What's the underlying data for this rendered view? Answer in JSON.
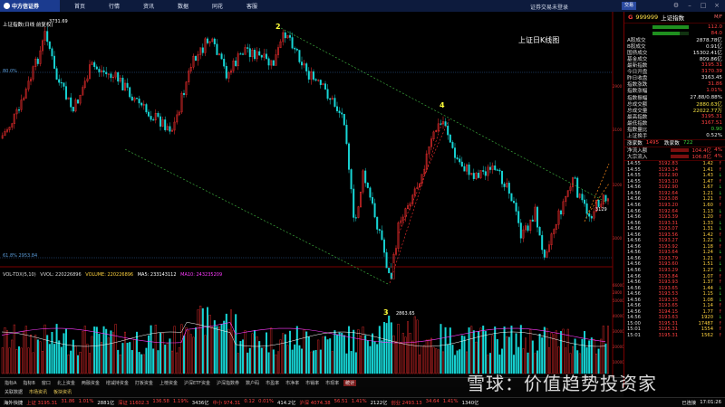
{
  "topbar": {
    "logo_text": "中方信证券",
    "menu": [
      "首页",
      "行情",
      "资讯",
      "数据",
      "同花",
      "客服"
    ],
    "app_title": "证券交易未登录",
    "login_label": "交易"
  },
  "chart": {
    "index_title": "上证指数(日线 前复权)",
    "annotation_title": "上证日K线图",
    "high_label": "3731.69",
    "low_label": "2863.65",
    "low_mark": "3",
    "wave_labels": [
      "2",
      "4"
    ],
    "left_pct_top": "80.0%",
    "left_pct_bottom": "61.8% 2953.84",
    "right_axis": [
      "3200",
      "3100",
      "3000",
      "2900",
      "2800"
    ],
    "vol_axis": [
      "66000",
      "50000",
      "40000",
      "30000",
      "20000",
      "10000"
    ],
    "current_label": "3129",
    "volume_legend": {
      "title": "VOL-TDX(5,10)",
      "vvol": "VVOL: 220226896",
      "volume": "VOLUME: 220226896",
      "ma5": "MA5: 233143112",
      "ma10": "MA10: 243235209"
    }
  },
  "right_panel": {
    "code": "999999",
    "name": "上证指数",
    "g_mark": "G",
    "tag": "M/F",
    "top_bars": [
      {
        "label": "",
        "value": "112.0"
      },
      {
        "label": "",
        "value": "84.0"
      }
    ],
    "quote_rows": [
      {
        "label": "A股成交",
        "value": "2878.78亿",
        "cls": "white"
      },
      {
        "label": "B股成交",
        "value": "0.91亿",
        "cls": "white"
      },
      {
        "label": "国债成交",
        "value": "15302.41亿",
        "cls": "white"
      },
      {
        "label": "基金成交",
        "value": "809.86亿",
        "cls": "white"
      },
      {
        "label": "最新指数",
        "value": "3195.31",
        "cls": "red"
      },
      {
        "label": "今日开盘",
        "value": "3170.39",
        "cls": "red"
      },
      {
        "label": "昨日收盘",
        "value": "3163.45",
        "cls": "white"
      },
      {
        "label": "指数涨跌",
        "value": "31.86",
        "cls": "red"
      },
      {
        "label": "指数涨幅",
        "value": "1.01%",
        "cls": "red"
      },
      {
        "label": "指数振幅",
        "value": "27.88/0.88%",
        "cls": "white"
      },
      {
        "label": "总成交额",
        "value": "2880.63亿",
        "cls": "yellow"
      },
      {
        "label": "总成交量",
        "value": "22022.77万",
        "cls": "yellow"
      },
      {
        "label": "最高指数",
        "value": "3195.31",
        "cls": "red"
      },
      {
        "label": "最低指数",
        "value": "3167.51",
        "cls": "red"
      },
      {
        "label": "指数量比",
        "value": "0.90",
        "cls": "green"
      },
      {
        "label": "上证换手",
        "value": "0.52%",
        "cls": "white"
      }
    ],
    "updown": {
      "up_label": "涨家数",
      "up": "1495",
      "down_label": "跌家数",
      "down": "722"
    },
    "flows": [
      {
        "label": "净流入额",
        "value": "104.4亿",
        "pct": "4%"
      },
      {
        "label": "大宗流入",
        "value": "106.8亿",
        "pct": "4%"
      }
    ],
    "ticks": [
      {
        "t": "14:55",
        "p": "3192.83",
        "v": "1.42",
        "d": "↑"
      },
      {
        "t": "14:55",
        "p": "3193.14",
        "v": "1.41",
        "d": "↑"
      },
      {
        "t": "14:55",
        "p": "3192.90",
        "v": "1.43",
        "d": "↓"
      },
      {
        "t": "14:55",
        "p": "3193.10",
        "v": "1.47",
        "d": "↑"
      },
      {
        "t": "14:56",
        "p": "3192.90",
        "v": "1.67",
        "d": "↓"
      },
      {
        "t": "14:56",
        "p": "3192.64",
        "v": "1.21",
        "d": "↓"
      },
      {
        "t": "14:56",
        "p": "3193.08",
        "v": "1.21",
        "d": "↑"
      },
      {
        "t": "14:56",
        "p": "3193.20",
        "v": "1.60",
        "d": "↑"
      },
      {
        "t": "14:56",
        "p": "3192.64",
        "v": "1.13",
        "d": "↓"
      },
      {
        "t": "14:56",
        "p": "3193.39",
        "v": "1.20",
        "d": "↑"
      },
      {
        "t": "14:56",
        "p": "3193.31",
        "v": "1.33",
        "d": "↓"
      },
      {
        "t": "14:56",
        "p": "3193.07",
        "v": "1.31",
        "d": "↓"
      },
      {
        "t": "14:56",
        "p": "3193.56",
        "v": "1.42",
        "d": "↑"
      },
      {
        "t": "14:56",
        "p": "3193.27",
        "v": "1.22",
        "d": "↓"
      },
      {
        "t": "14:56",
        "p": "3193.92",
        "v": "1.18",
        "d": "↑"
      },
      {
        "t": "14:56",
        "p": "3193.64",
        "v": "1.24",
        "d": "↓"
      },
      {
        "t": "14:56",
        "p": "3193.79",
        "v": "1.21",
        "d": "↑"
      },
      {
        "t": "14:56",
        "p": "3193.60",
        "v": "1.51",
        "d": "↓"
      },
      {
        "t": "14:56",
        "p": "3193.29",
        "v": "1.27",
        "d": "↓"
      },
      {
        "t": "14:56",
        "p": "3193.84",
        "v": "1.07",
        "d": "↑"
      },
      {
        "t": "14:56",
        "p": "3193.93",
        "v": "1.37",
        "d": "↑"
      },
      {
        "t": "14:56",
        "p": "3193.65",
        "v": "1.44",
        "d": "↓"
      },
      {
        "t": "14:56",
        "p": "3193.53",
        "v": "1.15",
        "d": "↓"
      },
      {
        "t": "14:56",
        "p": "3193.35",
        "v": "1.08",
        "d": "↓"
      },
      {
        "t": "14:56",
        "p": "3193.65",
        "v": "1.14",
        "d": "↑"
      },
      {
        "t": "14:56",
        "p": "3194.15",
        "v": "1.77",
        "d": "↑"
      },
      {
        "t": "14:56",
        "p": "3193.63",
        "v": "1920",
        "d": "↓"
      },
      {
        "t": "15:00",
        "p": "3195.31",
        "v": "17487",
        "d": "↑"
      },
      {
        "t": "15:01",
        "p": "3195.31",
        "v": "1554",
        "d": "↑"
      },
      {
        "t": "15:01",
        "p": "3195.31",
        "v": "1562",
        "d": "↑"
      }
    ]
  },
  "tabstrip": [
    "指标A",
    "指标B",
    "窗口",
    "北上资金",
    "两融资金",
    "增减持资金",
    "打板资金",
    "上榜资金",
    "沪深ETF资金",
    "沪深指数券",
    "数户码",
    "市盈率",
    "市净率",
    "市销率",
    "市现率",
    "统计"
  ],
  "tabstrip_sub": [
    "关联数据",
    "市场资讯",
    "板块资讯"
  ],
  "statusbar": {
    "items": [
      {
        "text": "海外快捷",
        "cls": "white"
      },
      {
        "text": "上证 3195.31",
        "cls": "red"
      },
      {
        "text": "31.86",
        "cls": "red"
      },
      {
        "text": "1.01%",
        "cls": "red"
      },
      {
        "text": "2881亿",
        "cls": "white"
      },
      {
        "text": "深证 11602.3",
        "cls": "red"
      },
      {
        "text": "136.58",
        "cls": "red"
      },
      {
        "text": "1.19%",
        "cls": "red"
      },
      {
        "text": "3436亿",
        "cls": "white"
      },
      {
        "text": "中小 974.31",
        "cls": "red"
      },
      {
        "text": "0.12",
        "cls": "red"
      },
      {
        "text": "0.01%",
        "cls": "red"
      },
      {
        "text": "414.2亿",
        "cls": "white"
      },
      {
        "text": "沪深 4074.38",
        "cls": "red"
      },
      {
        "text": "56.51",
        "cls": "red"
      },
      {
        "text": "1.41%",
        "cls": "red"
      },
      {
        "text": "2122亿",
        "cls": "white"
      },
      {
        "text": "创业 2493.13",
        "cls": "red"
      },
      {
        "text": "34.64",
        "cls": "red"
      },
      {
        "text": "1.41%",
        "cls": "red"
      },
      {
        "text": "1340亿",
        "cls": "white"
      }
    ],
    "right_text": "17:01:26",
    "right_status": "已连接"
  },
  "watermark": "雪球：价值趋势投资家",
  "colors": {
    "up": "#ff3030",
    "down": "#17d6d6",
    "ma": "#ffff3a",
    "channel": "#3ca83c",
    "orange": "#ff8c1a"
  }
}
